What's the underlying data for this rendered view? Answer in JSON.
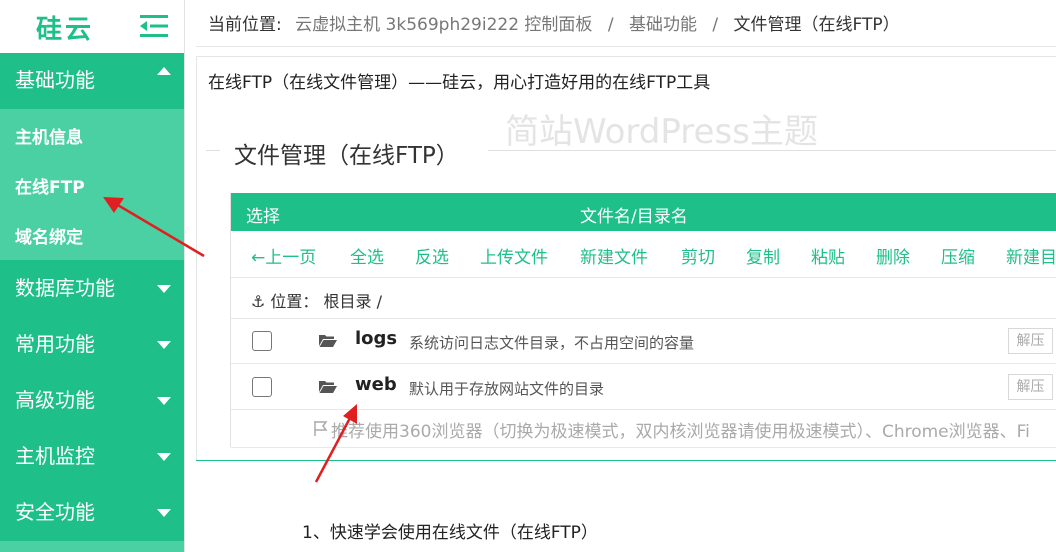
{
  "app": {
    "logo": "硅云"
  },
  "colors": {
    "accent": "#1fbf8a",
    "submenu": "#4bd0a3",
    "annotation": "#e02020"
  },
  "sidebar": {
    "menus": [
      {
        "label": "基础功能",
        "icon": "caret-up-icon"
      },
      {
        "label": "数据库功能",
        "icon": "caret-down-icon"
      },
      {
        "label": "常用功能",
        "icon": "caret-down-icon"
      },
      {
        "label": "高级功能",
        "icon": "caret-down-icon"
      },
      {
        "label": "主机监控",
        "icon": "caret-down-icon"
      },
      {
        "label": "安全功能",
        "icon": "caret-down-icon"
      }
    ],
    "submenu": [
      {
        "label": "主机信息"
      },
      {
        "label": "在线FTP"
      },
      {
        "label": "域名绑定"
      }
    ]
  },
  "breadcrumb": {
    "label": "当前位置:",
    "items": [
      "云虚拟主机 3k569ph29i222 控制面板",
      "基础功能",
      "文件管理（在线FTP）"
    ],
    "separator": "/"
  },
  "intro": "在线FTP（在线文件管理）——硅云，用心打造好用的在线FTP工具",
  "watermark": "简站WordPress主题",
  "section_title": "文件管理（在线FTP）",
  "table": {
    "header_select": "选择",
    "header_name": "文件名/目录名",
    "toolbar": [
      "←上一页",
      "全选",
      "反选",
      "上传文件",
      "新建文件",
      "剪切",
      "复制",
      "粘贴",
      "删除",
      "压缩",
      "新建目"
    ],
    "location": "⚓ 位置： 根目录 /",
    "rows": [
      {
        "name": "logs",
        "desc": "系统访问日志文件目录，不占用空间的容量",
        "action": "解压"
      },
      {
        "name": "web",
        "desc": "默认用于存放网站文件的目录",
        "action": "解压"
      }
    ],
    "hint": "推荐使用360浏览器（切换为极速模式，双内核浏览器请使用极速模式）、Chrome浏览器、Fi"
  },
  "footer_text": "1、快速学会使用在线文件（在线FTP）"
}
